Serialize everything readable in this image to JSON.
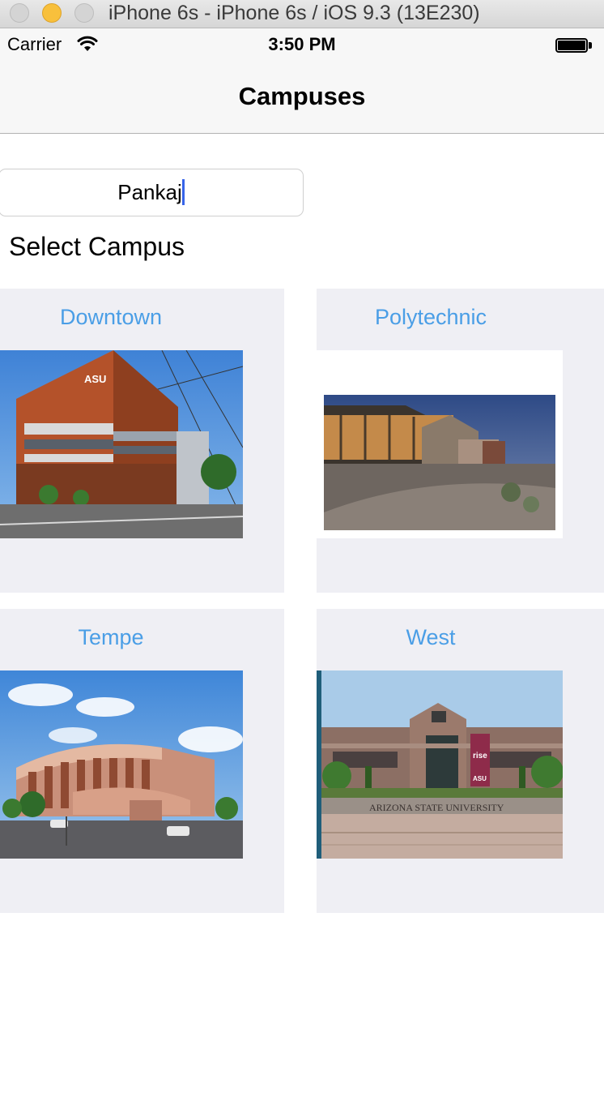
{
  "window": {
    "title": "iPhone 6s - iPhone 6s / iOS 9.3 (13E230)"
  },
  "status_bar": {
    "carrier": "Carrier",
    "time": "3:50 PM",
    "icons": [
      "wifi-icon",
      "battery-icon"
    ]
  },
  "nav": {
    "title": "Campuses"
  },
  "form": {
    "name_value": "Pankaj",
    "select_label": "Select Campus"
  },
  "campuses": [
    {
      "name": "Downtown",
      "image": "campus-building-photo"
    },
    {
      "name": "Polytechnic",
      "image": "campus-building-photo"
    },
    {
      "name": "Tempe",
      "image": "campus-building-photo"
    },
    {
      "name": "West",
      "image": "campus-building-photo"
    }
  ],
  "photo_signs": {
    "downtown_logo": "ASU",
    "west_sign": "ARIZONA STATE UNIVERSITY",
    "west_banner": "rise",
    "west_banner_sub": "ASU"
  },
  "colors": {
    "accent": "#4a9ee6",
    "card_background": "#efeff4",
    "caret": "#3764e9",
    "yellow_button": "#f8c03c"
  }
}
